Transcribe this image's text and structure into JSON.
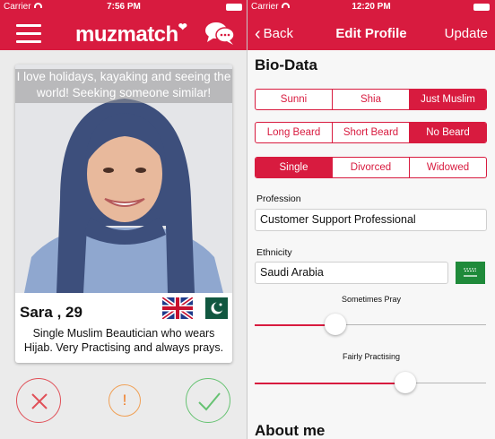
{
  "colors": {
    "brand": "#d81b3f",
    "dislike": "#e05058",
    "report": "#f07a20",
    "like": "#66c272"
  },
  "left_screen": {
    "status": {
      "carrier": "Carrier",
      "time": "7:56 PM"
    },
    "nav": {
      "logo_text": "muzmatch",
      "menu_icon": "hamburger-icon",
      "chat_icon": "chat-bubbles-icon"
    },
    "card": {
      "tagline": "I love holidays, kayaking and seeing the world! Seeking someone similar!",
      "name_age": "Sara , 29",
      "flags": [
        "united-kingdom-flag",
        "pakistan-flag"
      ],
      "bio": "Single Muslim Beautician who wears Hijab. Very Practising and always prays."
    },
    "actions": {
      "dislike_icon": "x-icon",
      "report_label": "!",
      "like_icon": "checkmark-icon"
    }
  },
  "right_screen": {
    "status": {
      "carrier": "Carrier",
      "time": "12:20 PM"
    },
    "nav": {
      "back_label": "Back",
      "title": "Edit Profile",
      "update_label": "Update"
    },
    "bio_data_title": "Bio-Data",
    "sect_options": [
      "Sunni",
      "Shia",
      "Just Muslim"
    ],
    "sect_selected": "Just Muslim",
    "beard_options": [
      "Long Beard",
      "Short Beard",
      "No Beard"
    ],
    "beard_selected": "No Beard",
    "marital_options": [
      "Single",
      "Divorced",
      "Widowed"
    ],
    "marital_selected": "Single",
    "profession": {
      "label": "Profession",
      "value": "Customer Support Professional"
    },
    "ethnicity": {
      "label": "Ethnicity",
      "value": "Saudi Arabia",
      "flag": "saudi-arabia-flag"
    },
    "prayer_slider": {
      "label": "Sometimes Pray",
      "value": 0.35
    },
    "practice_slider": {
      "label": "Fairly Practising",
      "value": 0.65
    },
    "about_me_title": "About me"
  }
}
